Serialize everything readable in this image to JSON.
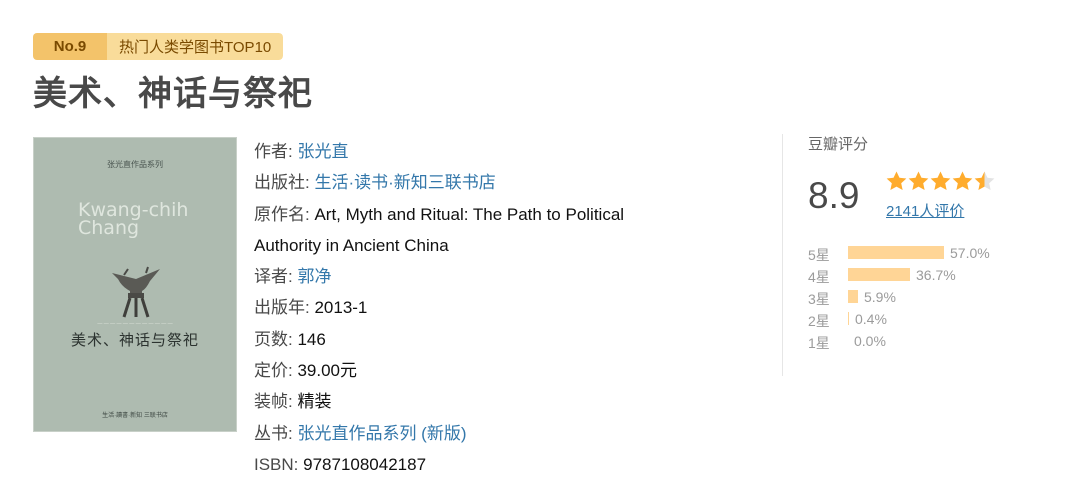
{
  "badge": {
    "rank": "No.9",
    "label": "热门人类学图书TOP10"
  },
  "book": {
    "title": "美术、神话与祭祀"
  },
  "cover": {
    "series": "张光直作品系列",
    "author": "Kwang-chih Chang",
    "title": "美术、神话与祭祀",
    "publisher": "生活·讀書·新知 三联书店"
  },
  "info": {
    "author_key": "作者: ",
    "author_val": "张光直",
    "publisher_key": "出版社: ",
    "publisher_val": "生活·读书·新知三联书店",
    "original_key": "原作名: ",
    "original_line1": "Art, Myth and Ritual: The Path to Political",
    "original_line2": "Authority in Ancient China",
    "translator_key": "译者: ",
    "translator_val": "郭净",
    "year_key": "出版年: ",
    "year_val": "2013-1",
    "pages_key": "页数: ",
    "pages_val": "146",
    "price_key": "定价: ",
    "price_val": "39.00元",
    "binding_key": "装帧: ",
    "binding_val": "精装",
    "series_key": "丛书: ",
    "series_val": "张光直作品系列 (新版)",
    "isbn_key": "ISBN: ",
    "isbn_val": "9787108042187"
  },
  "rating": {
    "header": "豆瓣评分",
    "score": "8.9",
    "stars": 4.5,
    "count": "2141人评价",
    "accent": "#ffac2d",
    "bar_color": "#ffd596",
    "breakdown": [
      {
        "label": "5星",
        "percent": 57.0,
        "text": "57.0%"
      },
      {
        "label": "4星",
        "percent": 36.7,
        "text": "36.7%"
      },
      {
        "label": "3星",
        "percent": 5.9,
        "text": "5.9%"
      },
      {
        "label": "2星",
        "percent": 0.4,
        "text": "0.4%"
      },
      {
        "label": "1星",
        "percent": 0.0,
        "text": "0.0%"
      }
    ]
  }
}
